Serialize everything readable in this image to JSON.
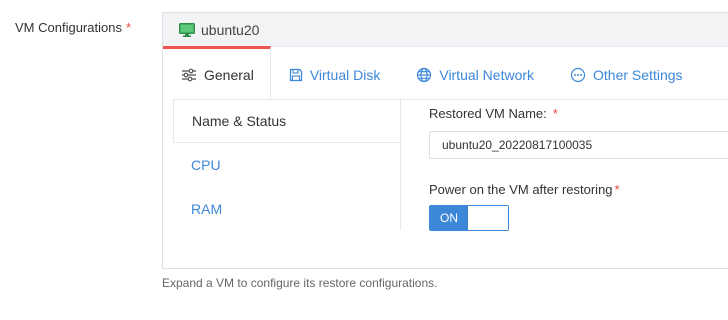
{
  "field": {
    "label": "VM Configurations",
    "required_mark": "*"
  },
  "vm": {
    "name": "ubuntu20"
  },
  "tabs": [
    {
      "label": "General",
      "icon": "sliders-icon"
    },
    {
      "label": "Virtual Disk",
      "icon": "save-disk-icon"
    },
    {
      "label": "Virtual Network",
      "icon": "globe-icon"
    },
    {
      "label": "Other Settings",
      "icon": "more-circle-icon"
    }
  ],
  "subnav": [
    {
      "label": "Name & Status"
    },
    {
      "label": "CPU"
    },
    {
      "label": "RAM"
    }
  ],
  "form": {
    "restored_name_label": "Restored VM Name:",
    "restored_name_required": "*",
    "restored_name_value": "ubuntu20_20220817100035",
    "power_on_label": "Power on the VM after restoring",
    "power_on_required": "*",
    "power_on_toggle": "ON"
  },
  "hint": "Expand a VM to configure its restore configurations.",
  "colors": {
    "accent": "#3d87d9",
    "active_tab_border": "#ef5350",
    "required": "#e6473d"
  }
}
